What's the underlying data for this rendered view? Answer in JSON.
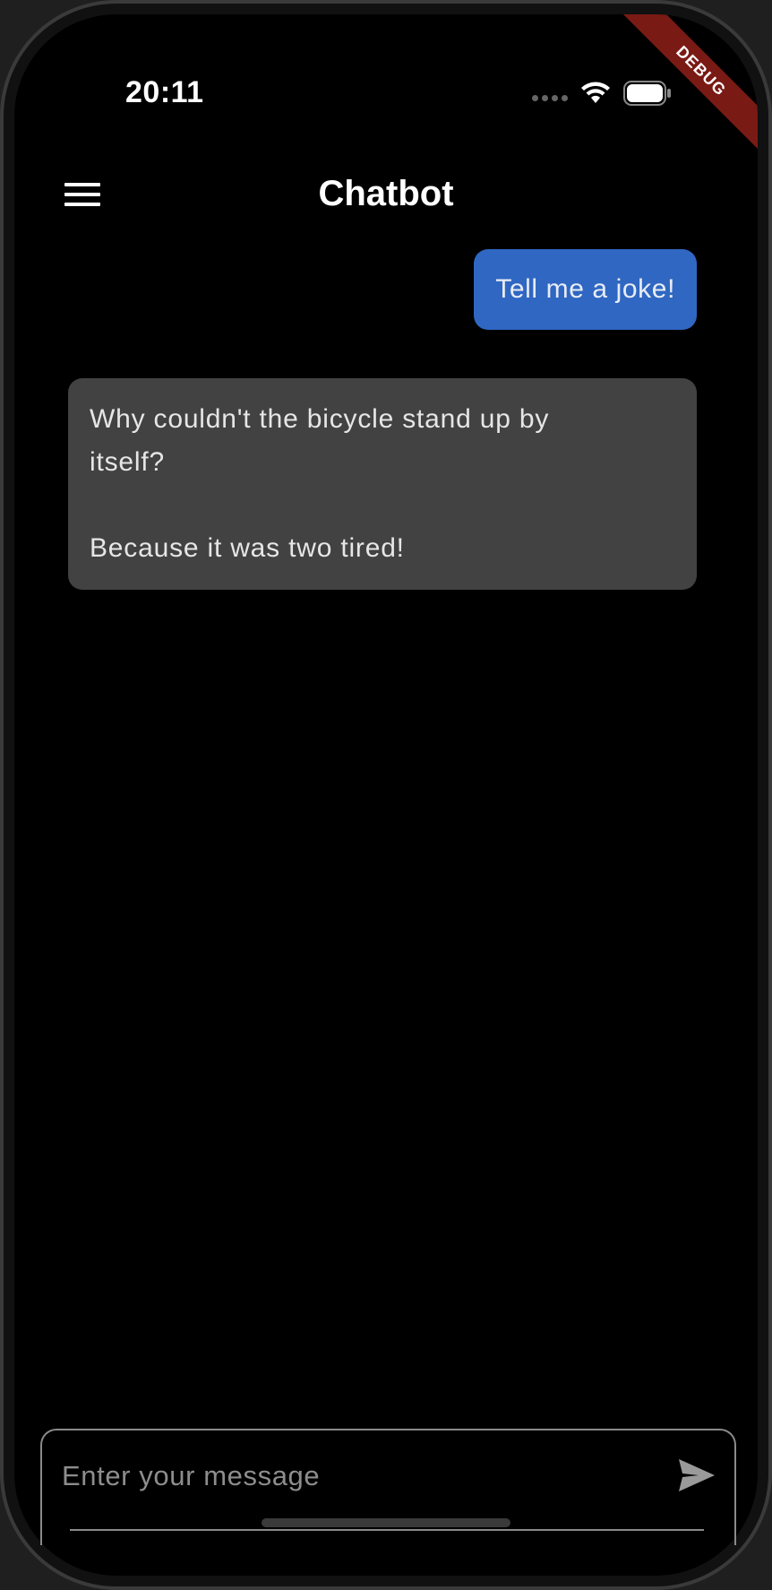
{
  "status_bar": {
    "time": "20:11"
  },
  "debug_banner": "DEBUG",
  "app_bar": {
    "title": "Chatbot",
    "menu_icon": "hamburger-menu-icon"
  },
  "messages": [
    {
      "role": "user",
      "text": "Tell me a joke!"
    },
    {
      "role": "bot",
      "text": "Why couldn't the bicycle stand up by\nitself?\n\nBecause it was two tired!"
    }
  ],
  "composer": {
    "placeholder": "Enter your message",
    "value": "",
    "send_icon": "send-icon"
  },
  "colors": {
    "user_bubble": "#2f67c2",
    "bot_bubble": "#424242",
    "background": "#000000",
    "debug_banner": "#7a1a14"
  }
}
